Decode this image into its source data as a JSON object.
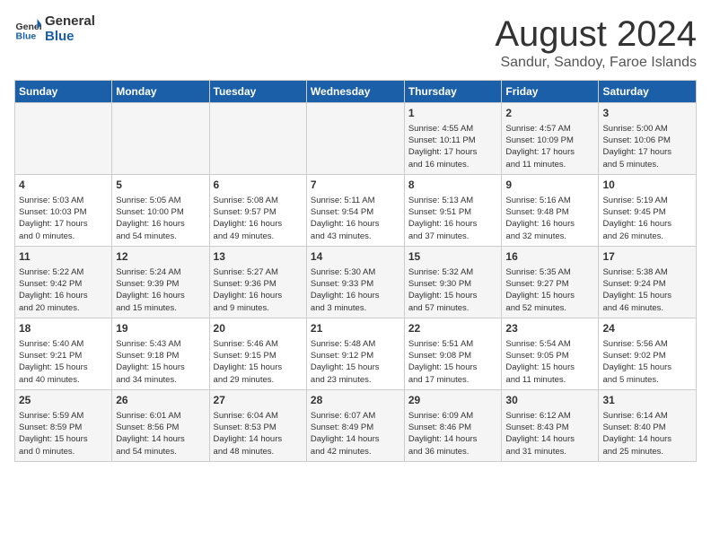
{
  "header": {
    "logo_general": "General",
    "logo_blue": "Blue",
    "month_title": "August 2024",
    "location": "Sandur, Sandoy, Faroe Islands"
  },
  "columns": [
    "Sunday",
    "Monday",
    "Tuesday",
    "Wednesday",
    "Thursday",
    "Friday",
    "Saturday"
  ],
  "weeks": [
    [
      {
        "day": "",
        "info": ""
      },
      {
        "day": "",
        "info": ""
      },
      {
        "day": "",
        "info": ""
      },
      {
        "day": "",
        "info": ""
      },
      {
        "day": "1",
        "info": "Sunrise: 4:55 AM\nSunset: 10:11 PM\nDaylight: 17 hours\nand 16 minutes."
      },
      {
        "day": "2",
        "info": "Sunrise: 4:57 AM\nSunset: 10:09 PM\nDaylight: 17 hours\nand 11 minutes."
      },
      {
        "day": "3",
        "info": "Sunrise: 5:00 AM\nSunset: 10:06 PM\nDaylight: 17 hours\nand 5 minutes."
      }
    ],
    [
      {
        "day": "4",
        "info": "Sunrise: 5:03 AM\nSunset: 10:03 PM\nDaylight: 17 hours\nand 0 minutes."
      },
      {
        "day": "5",
        "info": "Sunrise: 5:05 AM\nSunset: 10:00 PM\nDaylight: 16 hours\nand 54 minutes."
      },
      {
        "day": "6",
        "info": "Sunrise: 5:08 AM\nSunset: 9:57 PM\nDaylight: 16 hours\nand 49 minutes."
      },
      {
        "day": "7",
        "info": "Sunrise: 5:11 AM\nSunset: 9:54 PM\nDaylight: 16 hours\nand 43 minutes."
      },
      {
        "day": "8",
        "info": "Sunrise: 5:13 AM\nSunset: 9:51 PM\nDaylight: 16 hours\nand 37 minutes."
      },
      {
        "day": "9",
        "info": "Sunrise: 5:16 AM\nSunset: 9:48 PM\nDaylight: 16 hours\nand 32 minutes."
      },
      {
        "day": "10",
        "info": "Sunrise: 5:19 AM\nSunset: 9:45 PM\nDaylight: 16 hours\nand 26 minutes."
      }
    ],
    [
      {
        "day": "11",
        "info": "Sunrise: 5:22 AM\nSunset: 9:42 PM\nDaylight: 16 hours\nand 20 minutes."
      },
      {
        "day": "12",
        "info": "Sunrise: 5:24 AM\nSunset: 9:39 PM\nDaylight: 16 hours\nand 15 minutes."
      },
      {
        "day": "13",
        "info": "Sunrise: 5:27 AM\nSunset: 9:36 PM\nDaylight: 16 hours\nand 9 minutes."
      },
      {
        "day": "14",
        "info": "Sunrise: 5:30 AM\nSunset: 9:33 PM\nDaylight: 16 hours\nand 3 minutes."
      },
      {
        "day": "15",
        "info": "Sunrise: 5:32 AM\nSunset: 9:30 PM\nDaylight: 15 hours\nand 57 minutes."
      },
      {
        "day": "16",
        "info": "Sunrise: 5:35 AM\nSunset: 9:27 PM\nDaylight: 15 hours\nand 52 minutes."
      },
      {
        "day": "17",
        "info": "Sunrise: 5:38 AM\nSunset: 9:24 PM\nDaylight: 15 hours\nand 46 minutes."
      }
    ],
    [
      {
        "day": "18",
        "info": "Sunrise: 5:40 AM\nSunset: 9:21 PM\nDaylight: 15 hours\nand 40 minutes."
      },
      {
        "day": "19",
        "info": "Sunrise: 5:43 AM\nSunset: 9:18 PM\nDaylight: 15 hours\nand 34 minutes."
      },
      {
        "day": "20",
        "info": "Sunrise: 5:46 AM\nSunset: 9:15 PM\nDaylight: 15 hours\nand 29 minutes."
      },
      {
        "day": "21",
        "info": "Sunrise: 5:48 AM\nSunset: 9:12 PM\nDaylight: 15 hours\nand 23 minutes."
      },
      {
        "day": "22",
        "info": "Sunrise: 5:51 AM\nSunset: 9:08 PM\nDaylight: 15 hours\nand 17 minutes."
      },
      {
        "day": "23",
        "info": "Sunrise: 5:54 AM\nSunset: 9:05 PM\nDaylight: 15 hours\nand 11 minutes."
      },
      {
        "day": "24",
        "info": "Sunrise: 5:56 AM\nSunset: 9:02 PM\nDaylight: 15 hours\nand 5 minutes."
      }
    ],
    [
      {
        "day": "25",
        "info": "Sunrise: 5:59 AM\nSunset: 8:59 PM\nDaylight: 15 hours\nand 0 minutes."
      },
      {
        "day": "26",
        "info": "Sunrise: 6:01 AM\nSunset: 8:56 PM\nDaylight: 14 hours\nand 54 minutes."
      },
      {
        "day": "27",
        "info": "Sunrise: 6:04 AM\nSunset: 8:53 PM\nDaylight: 14 hours\nand 48 minutes."
      },
      {
        "day": "28",
        "info": "Sunrise: 6:07 AM\nSunset: 8:49 PM\nDaylight: 14 hours\nand 42 minutes."
      },
      {
        "day": "29",
        "info": "Sunrise: 6:09 AM\nSunset: 8:46 PM\nDaylight: 14 hours\nand 36 minutes."
      },
      {
        "day": "30",
        "info": "Sunrise: 6:12 AM\nSunset: 8:43 PM\nDaylight: 14 hours\nand 31 minutes."
      },
      {
        "day": "31",
        "info": "Sunrise: 6:14 AM\nSunset: 8:40 PM\nDaylight: 14 hours\nand 25 minutes."
      }
    ]
  ]
}
